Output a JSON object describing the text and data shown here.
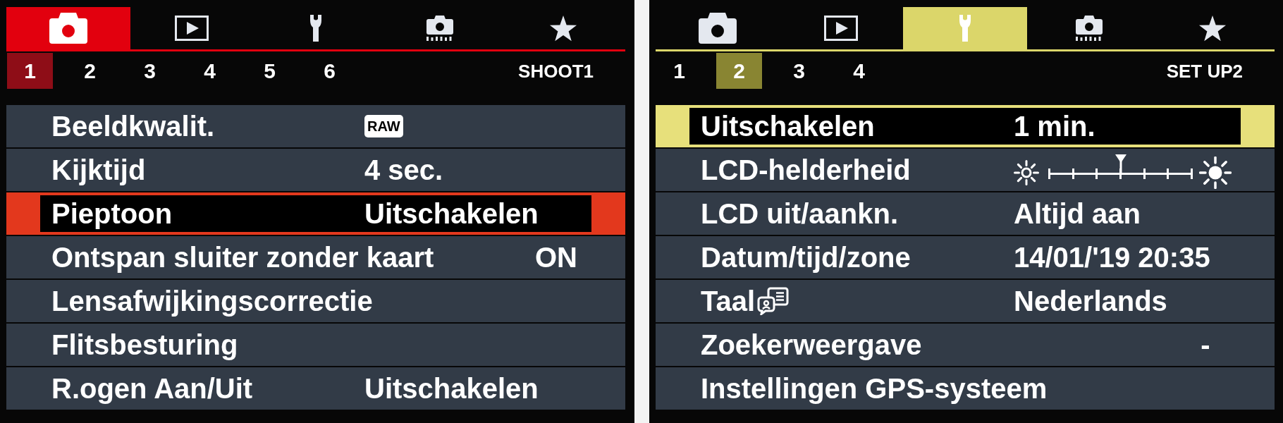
{
  "screens": [
    {
      "tabs": [
        {
          "kind": "shoot",
          "selected": true
        },
        {
          "kind": "playback",
          "selected": false
        },
        {
          "kind": "setup",
          "selected": false
        },
        {
          "kind": "custom",
          "selected": false
        },
        {
          "kind": "mymenu",
          "selected": false
        }
      ],
      "pages": [
        {
          "label": "1",
          "selected": true
        },
        {
          "label": "2",
          "selected": false
        },
        {
          "label": "3",
          "selected": false
        },
        {
          "label": "4",
          "selected": false
        },
        {
          "label": "5",
          "selected": false
        },
        {
          "label": "6",
          "selected": false
        }
      ],
      "page_title": "SHOOT1",
      "items": [
        {
          "kind": "badge",
          "label": "Beeldkwalit.",
          "value": "RAW",
          "selected": false
        },
        {
          "kind": "value",
          "label": "Kijktijd",
          "value": "4 sec.",
          "selected": false
        },
        {
          "kind": "value",
          "label": "Pieptoon",
          "value": "Uitschakelen",
          "selected": true
        },
        {
          "kind": "status",
          "label": "Ontspan sluiter zonder kaart",
          "value": "ON",
          "selected": false
        },
        {
          "kind": "submenu",
          "label": "Lensafwijkingscorrectie",
          "selected": false
        },
        {
          "kind": "submenu",
          "label": "Flitsbesturing",
          "selected": false
        },
        {
          "kind": "value",
          "label": "R.ogen Aan/Uit",
          "value": "Uitschakelen",
          "selected": false
        }
      ]
    },
    {
      "tabs": [
        {
          "kind": "shoot",
          "selected": false
        },
        {
          "kind": "playback",
          "selected": false
        },
        {
          "kind": "setup",
          "selected": true
        },
        {
          "kind": "custom",
          "selected": false
        },
        {
          "kind": "mymenu",
          "selected": false
        }
      ],
      "pages": [
        {
          "label": "1",
          "selected": false
        },
        {
          "label": "2",
          "selected": true
        },
        {
          "label": "3",
          "selected": false
        },
        {
          "label": "4",
          "selected": false
        }
      ],
      "page_title": "SET UP2",
      "items": [
        {
          "kind": "value",
          "label": "Uitschakelen",
          "value": "1 min.",
          "selected": true
        },
        {
          "kind": "slider",
          "label": "LCD-helderheid",
          "level": 0.5,
          "selected": false
        },
        {
          "kind": "value",
          "label": "LCD uit/aankn.",
          "value": "Altijd aan",
          "selected": false
        },
        {
          "kind": "value",
          "label": "Datum/tijd/zone",
          "value": "14/01/'19 20:35",
          "selected": false
        },
        {
          "kind": "language",
          "label": "Taal",
          "value": "Nederlands",
          "selected": false
        },
        {
          "kind": "status",
          "label": "Zoekerweergave",
          "value": "-",
          "selected": false
        },
        {
          "kind": "submenu",
          "label": "Instellingen GPS-systeem",
          "selected": false
        }
      ]
    }
  ]
}
